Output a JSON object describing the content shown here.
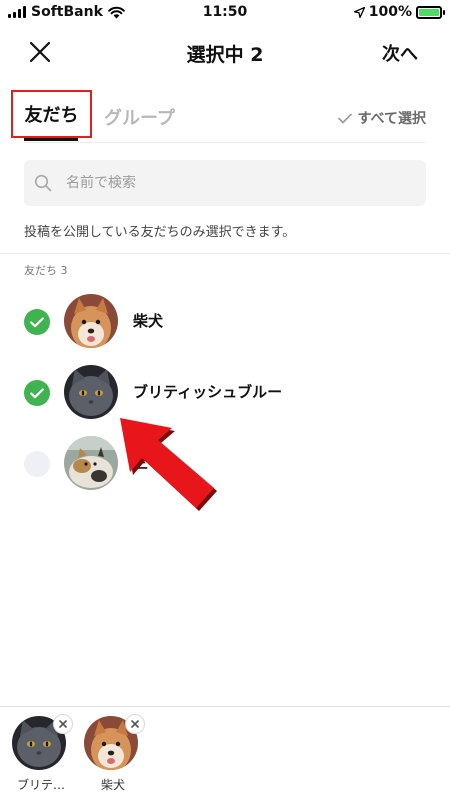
{
  "status_bar": {
    "carrier": "SoftBank",
    "time": "11:50",
    "battery": "100%",
    "battery_level": 1.0
  },
  "header": {
    "title": "選択中 2",
    "next_label": "次へ"
  },
  "tabs": {
    "friends_label": "友だち",
    "groups_label": "グループ",
    "select_all_label": "すべて選択",
    "highlight_color": "#e02020"
  },
  "search": {
    "placeholder": "名前で検索"
  },
  "notice": "投稿を公開している友だちのみ選択できます。",
  "section_header": "友だち 3",
  "friends": [
    {
      "name": "柴犬",
      "selected": true,
      "avatar": "shiba-dog"
    },
    {
      "name": "ブリティッシュブルー",
      "selected": true,
      "avatar": "british-blue-cat"
    },
    {
      "name": "三",
      "selected": false,
      "avatar": "calico-cat"
    }
  ],
  "selected_tray": [
    {
      "label": "ブリテ…",
      "avatar": "british-blue-cat"
    },
    {
      "label": "柴犬",
      "avatar": "shiba-dog"
    }
  ],
  "colors": {
    "check_on": "#3fb34f",
    "check_off": "#eef0f5",
    "arrow": "#e8161a"
  },
  "icons": [
    "close-icon",
    "search-icon",
    "checkmark-icon",
    "wifi-icon",
    "location-arrow-icon",
    "battery-icon",
    "pointer-arrow-icon"
  ]
}
